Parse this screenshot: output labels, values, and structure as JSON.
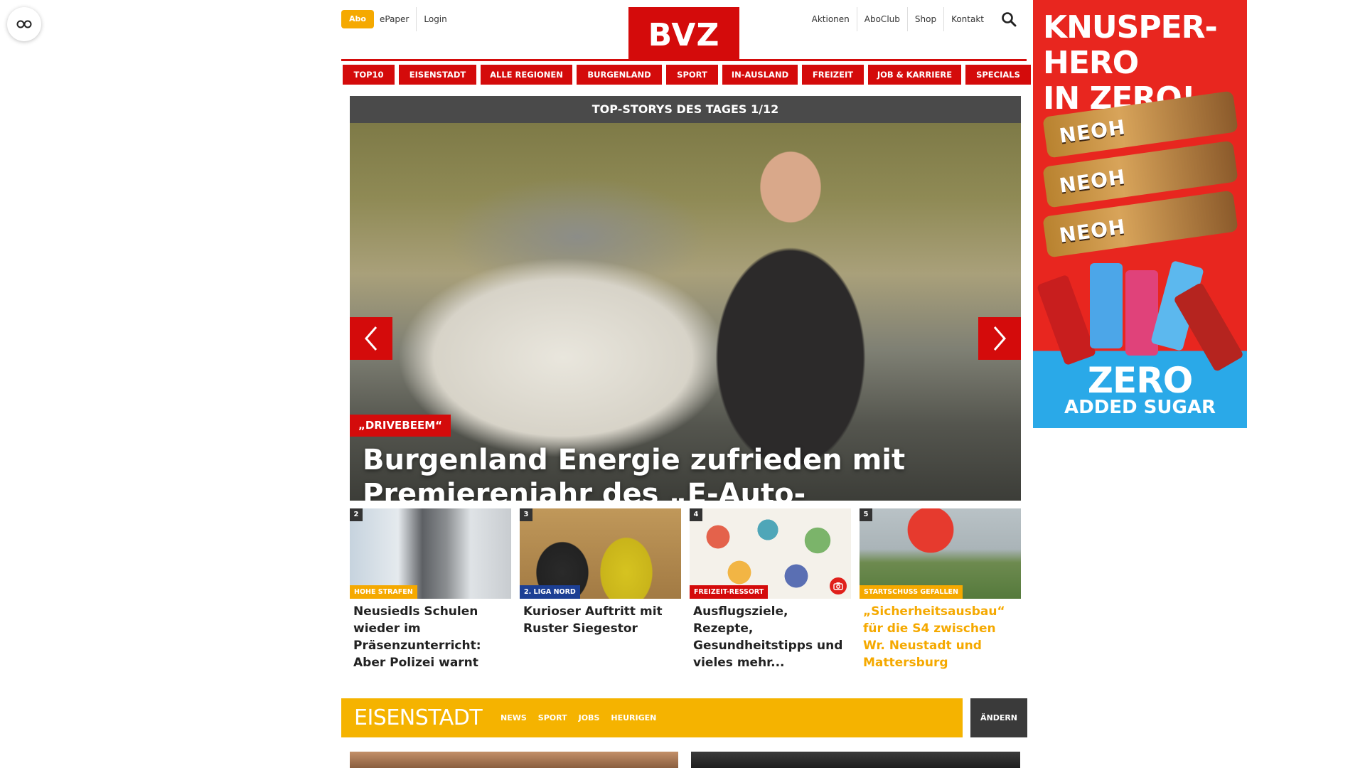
{
  "reader": {
    "icon": "glasses-icon"
  },
  "topbar": {
    "abo_label": "Abo",
    "left_links": [
      "ePaper",
      "Login"
    ],
    "logo_text": "BVZ",
    "right_links": [
      "Aktionen",
      "AboClub",
      "Shop",
      "Kontakt"
    ],
    "search_icon": "search-icon"
  },
  "nav": {
    "items": [
      "TOP10",
      "EISENSTADT",
      "ALLE REGIONEN",
      "BURGENLAND",
      "SPORT",
      "IN-AUSLAND",
      "FREIZEIT",
      "JOB & KARRIERE",
      "SPECIALS"
    ]
  },
  "hero": {
    "header": "TOP-STORYS DES TAGES 1/12",
    "tag": "„DRIVEBEEM“",
    "title": "Burgenland Energie zufrieden mit Premierenjahr des „E-Auto-Streamings“"
  },
  "cards": [
    {
      "num": "2",
      "tag": "HOHE STRAFEN",
      "tag_color": "#f5a900",
      "title": "Neusiedls Schulen wieder im Präsenzunterricht: Aber Polizei warnt",
      "orange": false
    },
    {
      "num": "3",
      "tag": "2. LIGA NORD",
      "tag_color": "#1c3f94",
      "title": "Kurioser Auftritt mit Ruster Siegestor",
      "orange": false
    },
    {
      "num": "4",
      "tag": "FREIZEIT-RESSORT",
      "tag_color": "#d40b0b",
      "title": "Ausflugsziele, Rezepte, Gesundheitstipps und vieles mehr...",
      "orange": false
    },
    {
      "num": "5",
      "tag": "STARTSCHUSS GEFALLEN",
      "tag_color": "#f5a900",
      "title": "„Sicherheitsausbau“ für die S4 zwischen Wr. Neustadt und Mattersburg",
      "orange": true
    }
  ],
  "region": {
    "title": "EISENSTADT",
    "links": [
      "NEWS",
      "SPORT",
      "JOBS",
      "HEURIGEN"
    ],
    "change_label": "ÄNDERN"
  },
  "ad": {
    "headline_1": "KNUSPER-HERO",
    "headline_2": "IN ZERO!",
    "bar_text": "NEOH",
    "zero": "ZERO",
    "sub": "ADDED SUGAR"
  },
  "colors": {
    "brand_red": "#d40b0b",
    "accent_yellow": "#f5b300",
    "dark": "#4a4a4a"
  }
}
